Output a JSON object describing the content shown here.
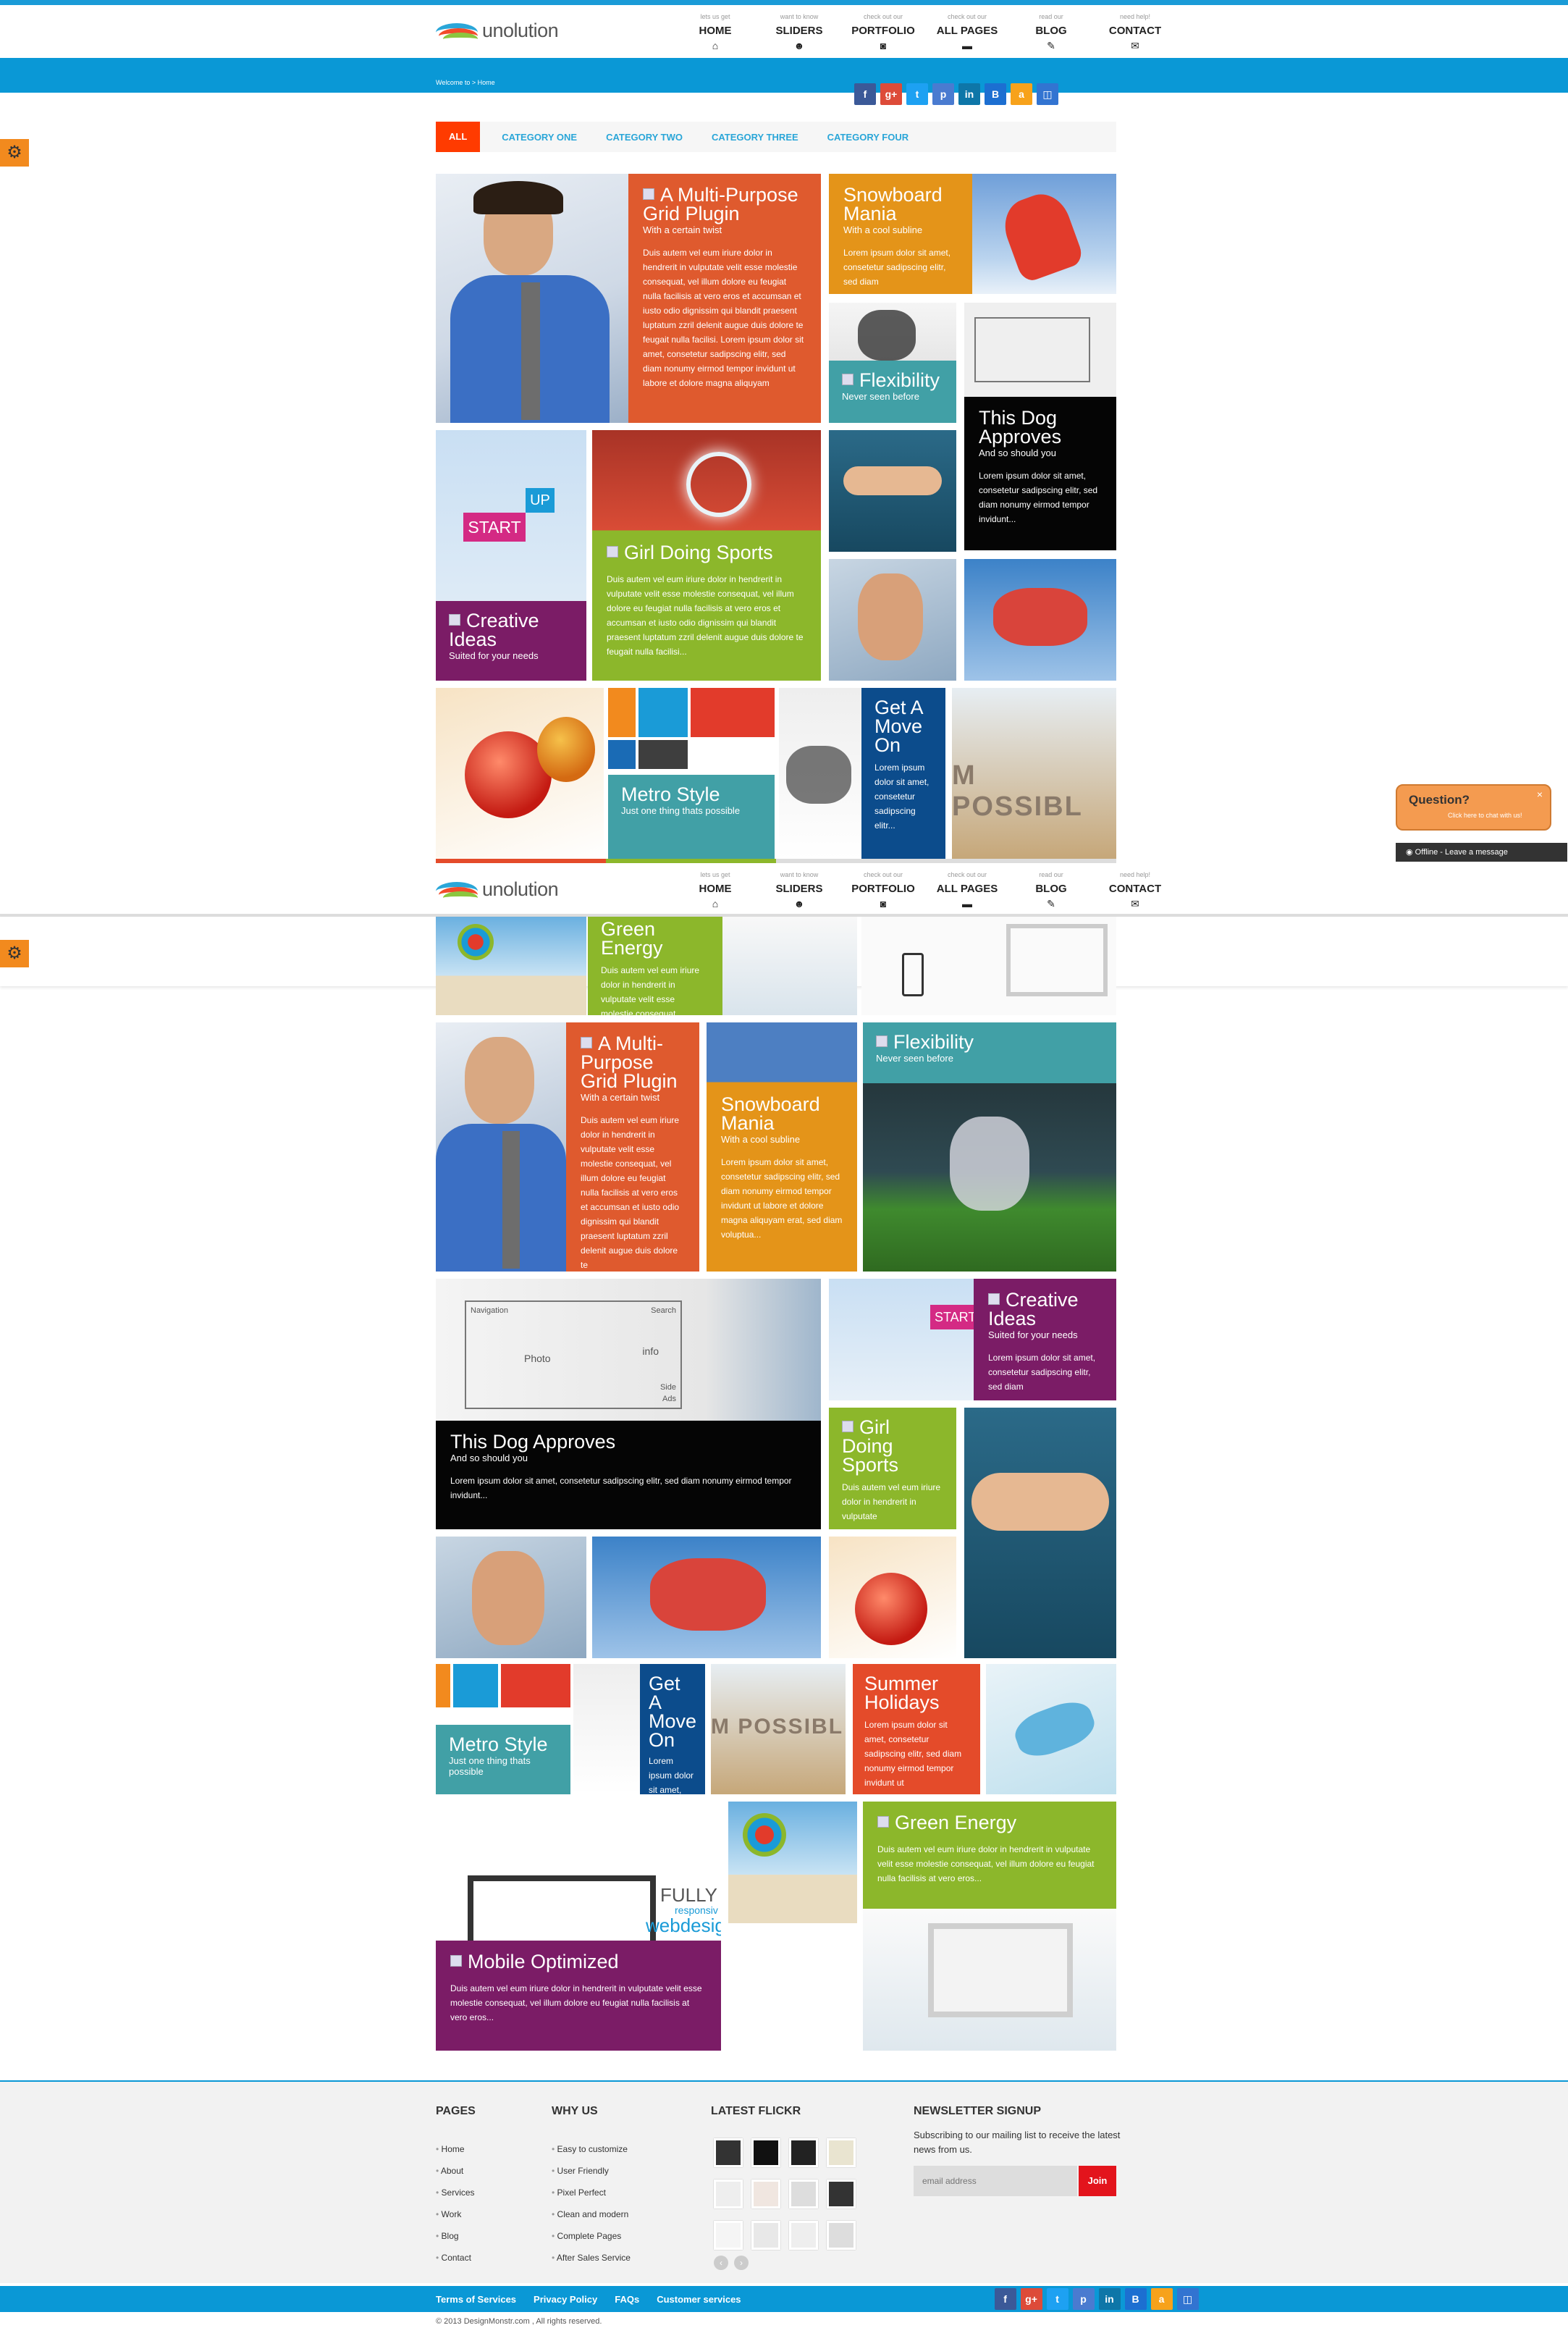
{
  "logo": {
    "text": "unolution"
  },
  "nav": [
    {
      "sub": "lets us get",
      "label": "HOME",
      "icon": "home-icon",
      "glyph": "⌂"
    },
    {
      "sub": "want to know",
      "label": "SLIDERS",
      "icon": "users-icon",
      "glyph": "☻"
    },
    {
      "sub": "check out our",
      "label": "PORTFOLIO",
      "icon": "camera-icon",
      "glyph": "◙"
    },
    {
      "sub": "check out our",
      "label": "ALL PAGES",
      "icon": "briefcase-icon",
      "glyph": "▬"
    },
    {
      "sub": "read our",
      "label": "BLOG",
      "icon": "pencil-icon",
      "glyph": "✎"
    },
    {
      "sub": "need help!",
      "label": "CONTACT",
      "icon": "envelope-icon",
      "glyph": "✉"
    }
  ],
  "breadcrumb": "Welcome to > Home",
  "social": [
    {
      "icon": "facebook-icon",
      "glyph": "f",
      "color": "#3b5998"
    },
    {
      "icon": "googleplus-icon",
      "glyph": "g+",
      "color": "#dd4b39"
    },
    {
      "icon": "twitter-icon",
      "glyph": "t",
      "color": "#1da1f2"
    },
    {
      "icon": "pinterest-icon",
      "glyph": "p",
      "color": "#4a7bd0"
    },
    {
      "icon": "linkedin-icon",
      "glyph": "in",
      "color": "#0e76a8"
    },
    {
      "icon": "blogger-icon",
      "glyph": "B",
      "color": "#1c6fd1"
    },
    {
      "icon": "orange-icon",
      "glyph": "a",
      "color": "#f7a21b"
    },
    {
      "icon": "delicious-icon",
      "glyph": "◫",
      "color": "#3274d1"
    }
  ],
  "filters": [
    "ALL",
    "CATEGORY ONE",
    "CATEGORY TWO",
    "CATEGORY THREE",
    "CATEGORY FOUR"
  ],
  "lorem_long": "Duis autem vel eum iriure dolor in hendrerit in vulputate velit esse molestie consequat, vel illum dolore eu feugiat nulla facilisis at vero eros et accumsan et iusto odio dignissim qui blandit praesent luptatum zzril delenit augue duis dolore te feugait nulla facilisi. Lorem ipsum dolor sit amet, consetetur sadipscing elitr, sed diam nonumy eirmod tempor invidunt ut labore et dolore magna aliquyam",
  "tiles": {
    "multi": {
      "title": "A Multi-Purpose Grid Plugin",
      "sub": "With a certain twist"
    },
    "snow": {
      "title": "Snowboard Mania",
      "sub": "With a cool subline",
      "text": "Lorem ipsum dolor sit amet, consetetur sadipscing elitr, sed diam"
    },
    "flex": {
      "title": "Flexibility",
      "sub": "Never seen before"
    },
    "dog": {
      "title": "This Dog Approves",
      "sub": "And so should you",
      "text": "Lorem ipsum dolor sit amet, consetetur sadipscing elitr, sed diam nonumy eirmod tempor invidunt..."
    },
    "creative": {
      "title": "Creative Ideas",
      "sub": "Suited for your needs"
    },
    "girl": {
      "title": "Girl Doing Sports",
      "text": "Duis autem vel eum iriure dolor in hendrerit in vulputate velit esse molestie consequat, vel illum dolore eu feugiat nulla facilisis at vero eros et accumsan et iusto odio dignissim qui blandit praesent luptatum zzril delenit augue duis dolore te feugait nulla facilisi..."
    },
    "metro": {
      "title": "Metro Style",
      "sub": "Just one thing thats possible"
    },
    "move": {
      "title": "Get A Move On",
      "text": "Lorem ipsum dolor sit amet, consetetur sadipscing elitr..."
    },
    "start": "START",
    "up": "UP",
    "possible": "M POSSIBL",
    "green": {
      "title": "Green Energy",
      "text": "Duis autem vel eum iriure dolor in hendrerit in vulputate velit esse molestie consequat..."
    },
    "green2": {
      "title": "Green Energy",
      "text": "Duis autem vel eum iriure dolor in hendrerit in vulputate velit esse molestie consequat, vel illum dolore eu feugiat nulla facilisis at vero eros..."
    },
    "multi2": {
      "title": "A Multi-Purpose Grid Plugin",
      "sub": "With a certain twist",
      "text": "Duis autem vel eum iriure dolor in hendrerit in vulputate velit esse molestie consequat, vel illum dolore eu feugiat nulla facilisis at vero eros et accumsan et iusto odio dignissim qui blandit praesent luptatum zzril delenit augue duis dolore te"
    },
    "snow2": {
      "title": "Snowboard Mania",
      "sub": "With a cool subline",
      "text": "Lorem ipsum dolor sit amet, consetetur sadipscing elitr, sed diam nonumy eirmod tempor invidunt ut labore et dolore magna aliquyam erat, sed diam voluptua..."
    },
    "dog2": {
      "title": "This Dog Approves",
      "sub": "And so should you",
      "text": "Lorem ipsum dolor sit amet, consetetur sadipscing elitr, sed diam nonumy eirmod tempor invidunt..."
    },
    "creative2": {
      "title": "Creative Ideas",
      "sub": "Suited for your needs",
      "text": "Lorem ipsum dolor sit amet, consetetur sadipscing elitr, sed diam"
    },
    "girl2": {
      "title": "Girl Doing Sports",
      "text": "Duis autem vel eum iriure dolor in hendrerit in vulputate"
    },
    "summer": {
      "title": "Summer Holidays",
      "text": "Lorem ipsum dolor sit amet, consetetur sadipscing elitr, sed diam nonumy eirmod tempor invidunt ut"
    },
    "mobile": {
      "title": "Mobile Optimized",
      "text": "Duis autem vel eum iriure dolor in hendrerit in vulputate velit esse molestie consequat, vel illum dolore eu feugiat nulla facilisis at vero eros..."
    },
    "fully": {
      "a": "FULLY",
      "b": "responsiv",
      "c": "webdesign"
    },
    "sketch": {
      "search": "Search",
      "nav": "Navigation",
      "photo": "Photo",
      "info": "info",
      "side": "Side",
      "ads": "Ads"
    }
  },
  "chat": {
    "title": "Question?",
    "sub": "Click here to chat with us!",
    "offline": "Offline - Leave a message",
    "offline_bold": "Offline"
  },
  "footer": {
    "pages_title": "PAGES",
    "pages": [
      "Home",
      "About",
      "Services",
      "Work",
      "Blog",
      "Contact"
    ],
    "why_title": "WHY US",
    "why": [
      "Easy to customize",
      "User Friendly",
      "Pixel Perfect",
      "Clean and modern",
      "Complete Pages",
      "After Sales Service"
    ],
    "flickr_title": "LATEST FLICKR",
    "news_title": "NEWSLETTER SIGNUP",
    "news_text": "Subscribing to our mailing list to receive the latest news from us.",
    "email_placeholder": "email address",
    "join": "Join",
    "links": [
      "Terms of Services",
      "Privacy Policy",
      "FAQs",
      "Customer services"
    ],
    "copyright": "© 2013 DesignMonstr.com , All rights reserved."
  }
}
